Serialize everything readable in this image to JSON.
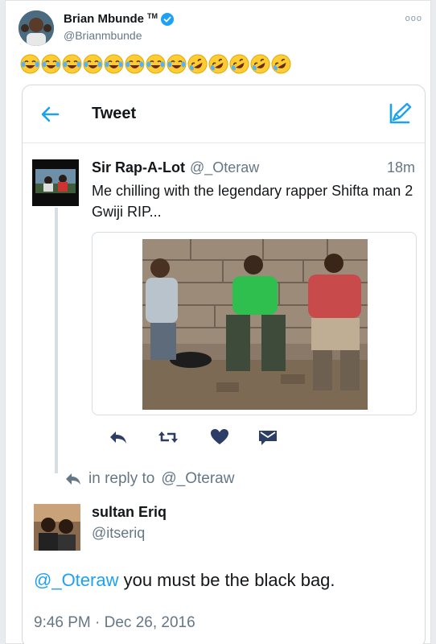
{
  "author": {
    "name": "Brian Mbunde",
    "tm": "TM",
    "handle": "@Brianmbunde",
    "more_label": "ooo"
  },
  "emojis": [
    "joy",
    "joy",
    "joy",
    "joy",
    "joy",
    "joy",
    "joy",
    "joy",
    "rofl",
    "rofl",
    "rofl",
    "rofl",
    "rofl"
  ],
  "embedded": {
    "header_title": "Tweet",
    "tweet": {
      "name": "Sir Rap-A-Lot",
      "handle": "@_Oteraw",
      "time": "18m",
      "text": "Me chilling with the legendary rapper Shifta man 2 Gwiji RIP..."
    },
    "reply_context": {
      "prefix": "in reply to",
      "handle": "@_Oteraw"
    },
    "reply": {
      "name": "sultan Eriq",
      "handle": "@itseriq",
      "mention": "@_Oteraw",
      "text": " you must be the black bag."
    },
    "timestamp": "9:46 PM · Dec 26, 2016"
  },
  "colors": {
    "accent": "#1da1f2",
    "muted": "#657786",
    "action_icon": "#2c3e66"
  }
}
